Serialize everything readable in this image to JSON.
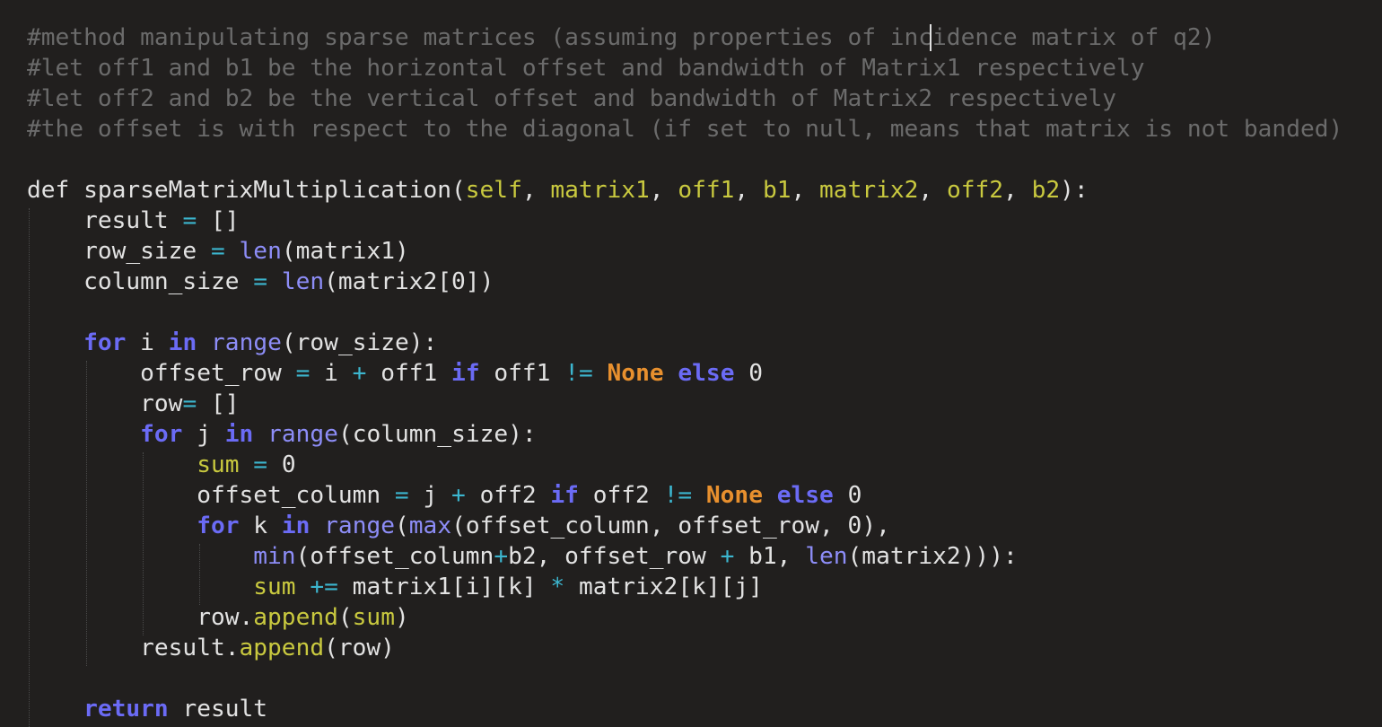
{
  "editor": {
    "lines": [
      [
        [
          "c",
          "#method manipulating sparse matrices (assuming properties of incidence matrix of q2)"
        ]
      ],
      [
        [
          "c",
          "#let off1 and b1 be the horizontal offset and bandwidth of Matrix1 respectively"
        ]
      ],
      [
        [
          "c",
          "#let off2 and b2 be the vertical offset and bandwidth of Matrix2 respectively"
        ]
      ],
      [
        [
          "c",
          "#the offset is with respect to the diagonal (if set to null, means that matrix is not banded)"
        ]
      ],
      [],
      [
        [
          "p",
          "def sparseMatrixMultiplication("
        ],
        [
          "a",
          "self"
        ],
        [
          "p",
          ", "
        ],
        [
          "a",
          "matrix1"
        ],
        [
          "p",
          ", "
        ],
        [
          "a",
          "off1"
        ],
        [
          "p",
          ", "
        ],
        [
          "a",
          "b1"
        ],
        [
          "p",
          ", "
        ],
        [
          "a",
          "matrix2"
        ],
        [
          "p",
          ", "
        ],
        [
          "a",
          "off2"
        ],
        [
          "p",
          ", "
        ],
        [
          "a",
          "b2"
        ],
        [
          "p",
          "):"
        ]
      ],
      [
        [
          "p",
          "    result "
        ],
        [
          "o",
          "="
        ],
        [
          "p",
          " []"
        ]
      ],
      [
        [
          "p",
          "    row_size "
        ],
        [
          "o",
          "="
        ],
        [
          "p",
          " "
        ],
        [
          "b",
          "len"
        ],
        [
          "p",
          "(matrix1)"
        ]
      ],
      [
        [
          "p",
          "    column_size "
        ],
        [
          "o",
          "="
        ],
        [
          "p",
          " "
        ],
        [
          "b",
          "len"
        ],
        [
          "p",
          "(matrix2[0])"
        ]
      ],
      [],
      [
        [
          "p",
          "    "
        ],
        [
          "k",
          "for"
        ],
        [
          "p",
          " i "
        ],
        [
          "k",
          "in"
        ],
        [
          "p",
          " "
        ],
        [
          "b",
          "range"
        ],
        [
          "p",
          "(row_size):"
        ]
      ],
      [
        [
          "p",
          "        offset_row "
        ],
        [
          "o",
          "="
        ],
        [
          "p",
          " i "
        ],
        [
          "o",
          "+"
        ],
        [
          "p",
          " off1 "
        ],
        [
          "k",
          "if"
        ],
        [
          "p",
          " off1 "
        ],
        [
          "o",
          "!="
        ],
        [
          "p",
          " "
        ],
        [
          "n",
          "None"
        ],
        [
          "p",
          " "
        ],
        [
          "k",
          "else"
        ],
        [
          "p",
          " 0"
        ]
      ],
      [
        [
          "p",
          "        row"
        ],
        [
          "o",
          "="
        ],
        [
          "p",
          " []"
        ]
      ],
      [
        [
          "p",
          "        "
        ],
        [
          "k",
          "for"
        ],
        [
          "p",
          " j "
        ],
        [
          "k",
          "in"
        ],
        [
          "p",
          " "
        ],
        [
          "b",
          "range"
        ],
        [
          "p",
          "(column_size):"
        ]
      ],
      [
        [
          "p",
          "            "
        ],
        [
          "a",
          "sum"
        ],
        [
          "p",
          " "
        ],
        [
          "o",
          "="
        ],
        [
          "p",
          " 0"
        ]
      ],
      [
        [
          "p",
          "            offset_column "
        ],
        [
          "o",
          "="
        ],
        [
          "p",
          " j "
        ],
        [
          "o",
          "+"
        ],
        [
          "p",
          " off2 "
        ],
        [
          "k",
          "if"
        ],
        [
          "p",
          " off2 "
        ],
        [
          "o",
          "!="
        ],
        [
          "p",
          " "
        ],
        [
          "n",
          "None"
        ],
        [
          "p",
          " "
        ],
        [
          "k",
          "else"
        ],
        [
          "p",
          " 0"
        ]
      ],
      [
        [
          "p",
          "            "
        ],
        [
          "k",
          "for"
        ],
        [
          "p",
          " k "
        ],
        [
          "k",
          "in"
        ],
        [
          "p",
          " "
        ],
        [
          "b",
          "range"
        ],
        [
          "p",
          "("
        ],
        [
          "b",
          "max"
        ],
        [
          "p",
          "(offset_column, offset_row, 0),"
        ]
      ],
      [
        [
          "p",
          "                "
        ],
        [
          "b",
          "min"
        ],
        [
          "p",
          "(offset_column"
        ],
        [
          "o",
          "+"
        ],
        [
          "p",
          "b2, offset_row "
        ],
        [
          "o",
          "+"
        ],
        [
          "p",
          " b1, "
        ],
        [
          "b",
          "len"
        ],
        [
          "p",
          "(matrix2))):"
        ]
      ],
      [
        [
          "p",
          "                "
        ],
        [
          "a",
          "sum"
        ],
        [
          "p",
          " "
        ],
        [
          "o",
          "+="
        ],
        [
          "p",
          " matrix1[i][k] "
        ],
        [
          "o",
          "*"
        ],
        [
          "p",
          " matrix2[k][j]"
        ]
      ],
      [
        [
          "p",
          "            row."
        ],
        [
          "a",
          "append"
        ],
        [
          "p",
          "("
        ],
        [
          "a",
          "sum"
        ],
        [
          "p",
          ")"
        ]
      ],
      [
        [
          "p",
          "        result."
        ],
        [
          "a",
          "append"
        ],
        [
          "p",
          "(row)"
        ]
      ],
      [],
      [
        [
          "p",
          "    "
        ],
        [
          "k",
          "return"
        ],
        [
          "p",
          " result"
        ]
      ]
    ]
  }
}
